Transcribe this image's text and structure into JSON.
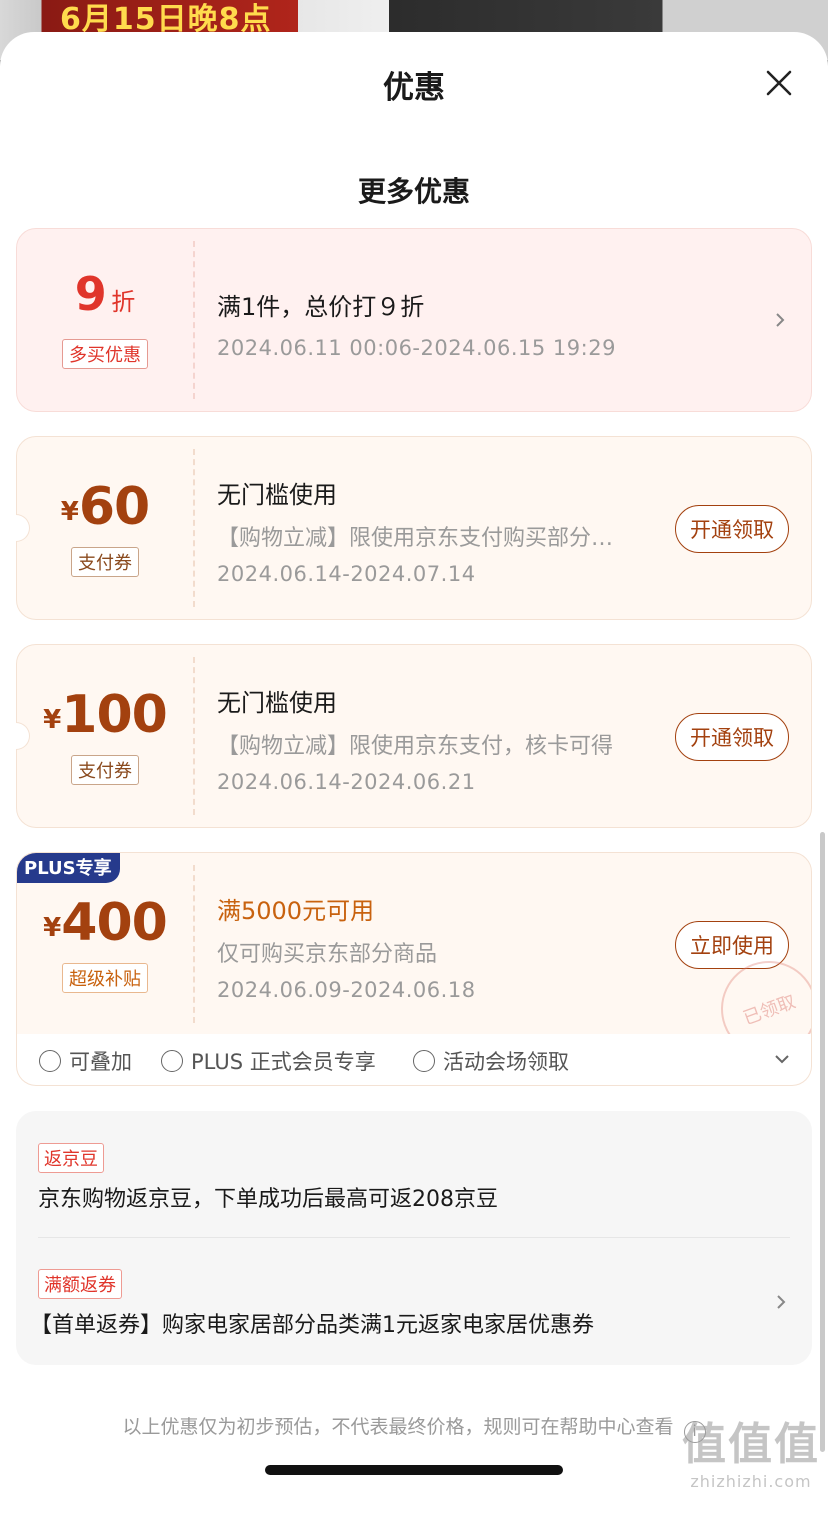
{
  "background": {
    "promo_text": "6月15日晚8点"
  },
  "sheet": {
    "title": "优惠",
    "section_title": "更多优惠"
  },
  "coupons": [
    {
      "amount": "9",
      "unit": "折",
      "tag": "多买优惠",
      "title": "满1件，总价打９折",
      "date": "2024.06.11 00:06-2024.06.15 19:29"
    },
    {
      "yen": "¥",
      "amount": "60",
      "tag": "支付券",
      "title": "无门槛使用",
      "desc": "【购物立减】限使用京东支付购买部分…",
      "date": "2024.06.14-2024.07.14",
      "button": "开通领取"
    },
    {
      "yen": "¥",
      "amount": "100",
      "tag": "支付券",
      "title": "无门槛使用",
      "desc": "【购物立减】限使用京东支付，核卡可得",
      "date": "2024.06.14-2024.06.21",
      "button": "开通领取"
    },
    {
      "badge": "PLUS专享",
      "yen": "¥",
      "amount": "400",
      "tag": "超级补贴",
      "title": "满5000元可用",
      "desc": "仅可购买京东部分商品",
      "date": "2024.06.09-2024.06.18",
      "button": "立即使用",
      "stamp": "已领取"
    }
  ],
  "plus_perks": [
    "可叠加",
    "PLUS 正式会员专享",
    "活动会场领取"
  ],
  "rebates": [
    {
      "tag": "返京豆",
      "text": "京东购物返京豆，下单成功后最高可返208京豆"
    },
    {
      "tag": "满额返券",
      "text": "【首单返券】购家电家居部分品类满1元返家电家居优惠券"
    }
  ],
  "disclaimer": "以上优惠仅为初步预估，不代表最终价格，规则可在帮助中心查看",
  "watermark": {
    "big": "值值值",
    "small": "zhizhizhi.com"
  },
  "colors": {
    "accent": "#a3410f",
    "red": "#e0352b",
    "plus_blue": "#263a8c",
    "title_orange": "#c8620f"
  }
}
